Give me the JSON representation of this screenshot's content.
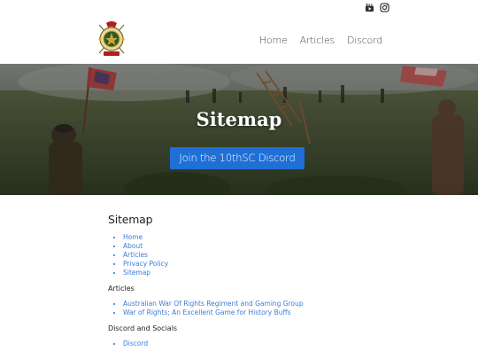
{
  "social": [
    {
      "icon": "youtube-icon"
    },
    {
      "icon": "instagram-icon"
    }
  ],
  "nav": {
    "items": [
      "Home",
      "Articles",
      "Discord"
    ]
  },
  "hero": {
    "title": "Sitemap",
    "button_label": "Join the 10thSC Discord"
  },
  "main": {
    "heading": "Sitemap",
    "pages": [
      "Home",
      "About",
      "Articles",
      "Privacy Policy",
      "Sitemap"
    ],
    "articles_heading": "Articles",
    "articles": [
      "Australian War Of Rights Regiment and Gaming Group",
      "War of Rights; An Excellent Game for History Buffs"
    ],
    "discord_heading": "Discord and Socials",
    "discord": [
      "Discord"
    ]
  },
  "colors": {
    "link": "#3b7dd8",
    "button": "#1f6fd6"
  }
}
